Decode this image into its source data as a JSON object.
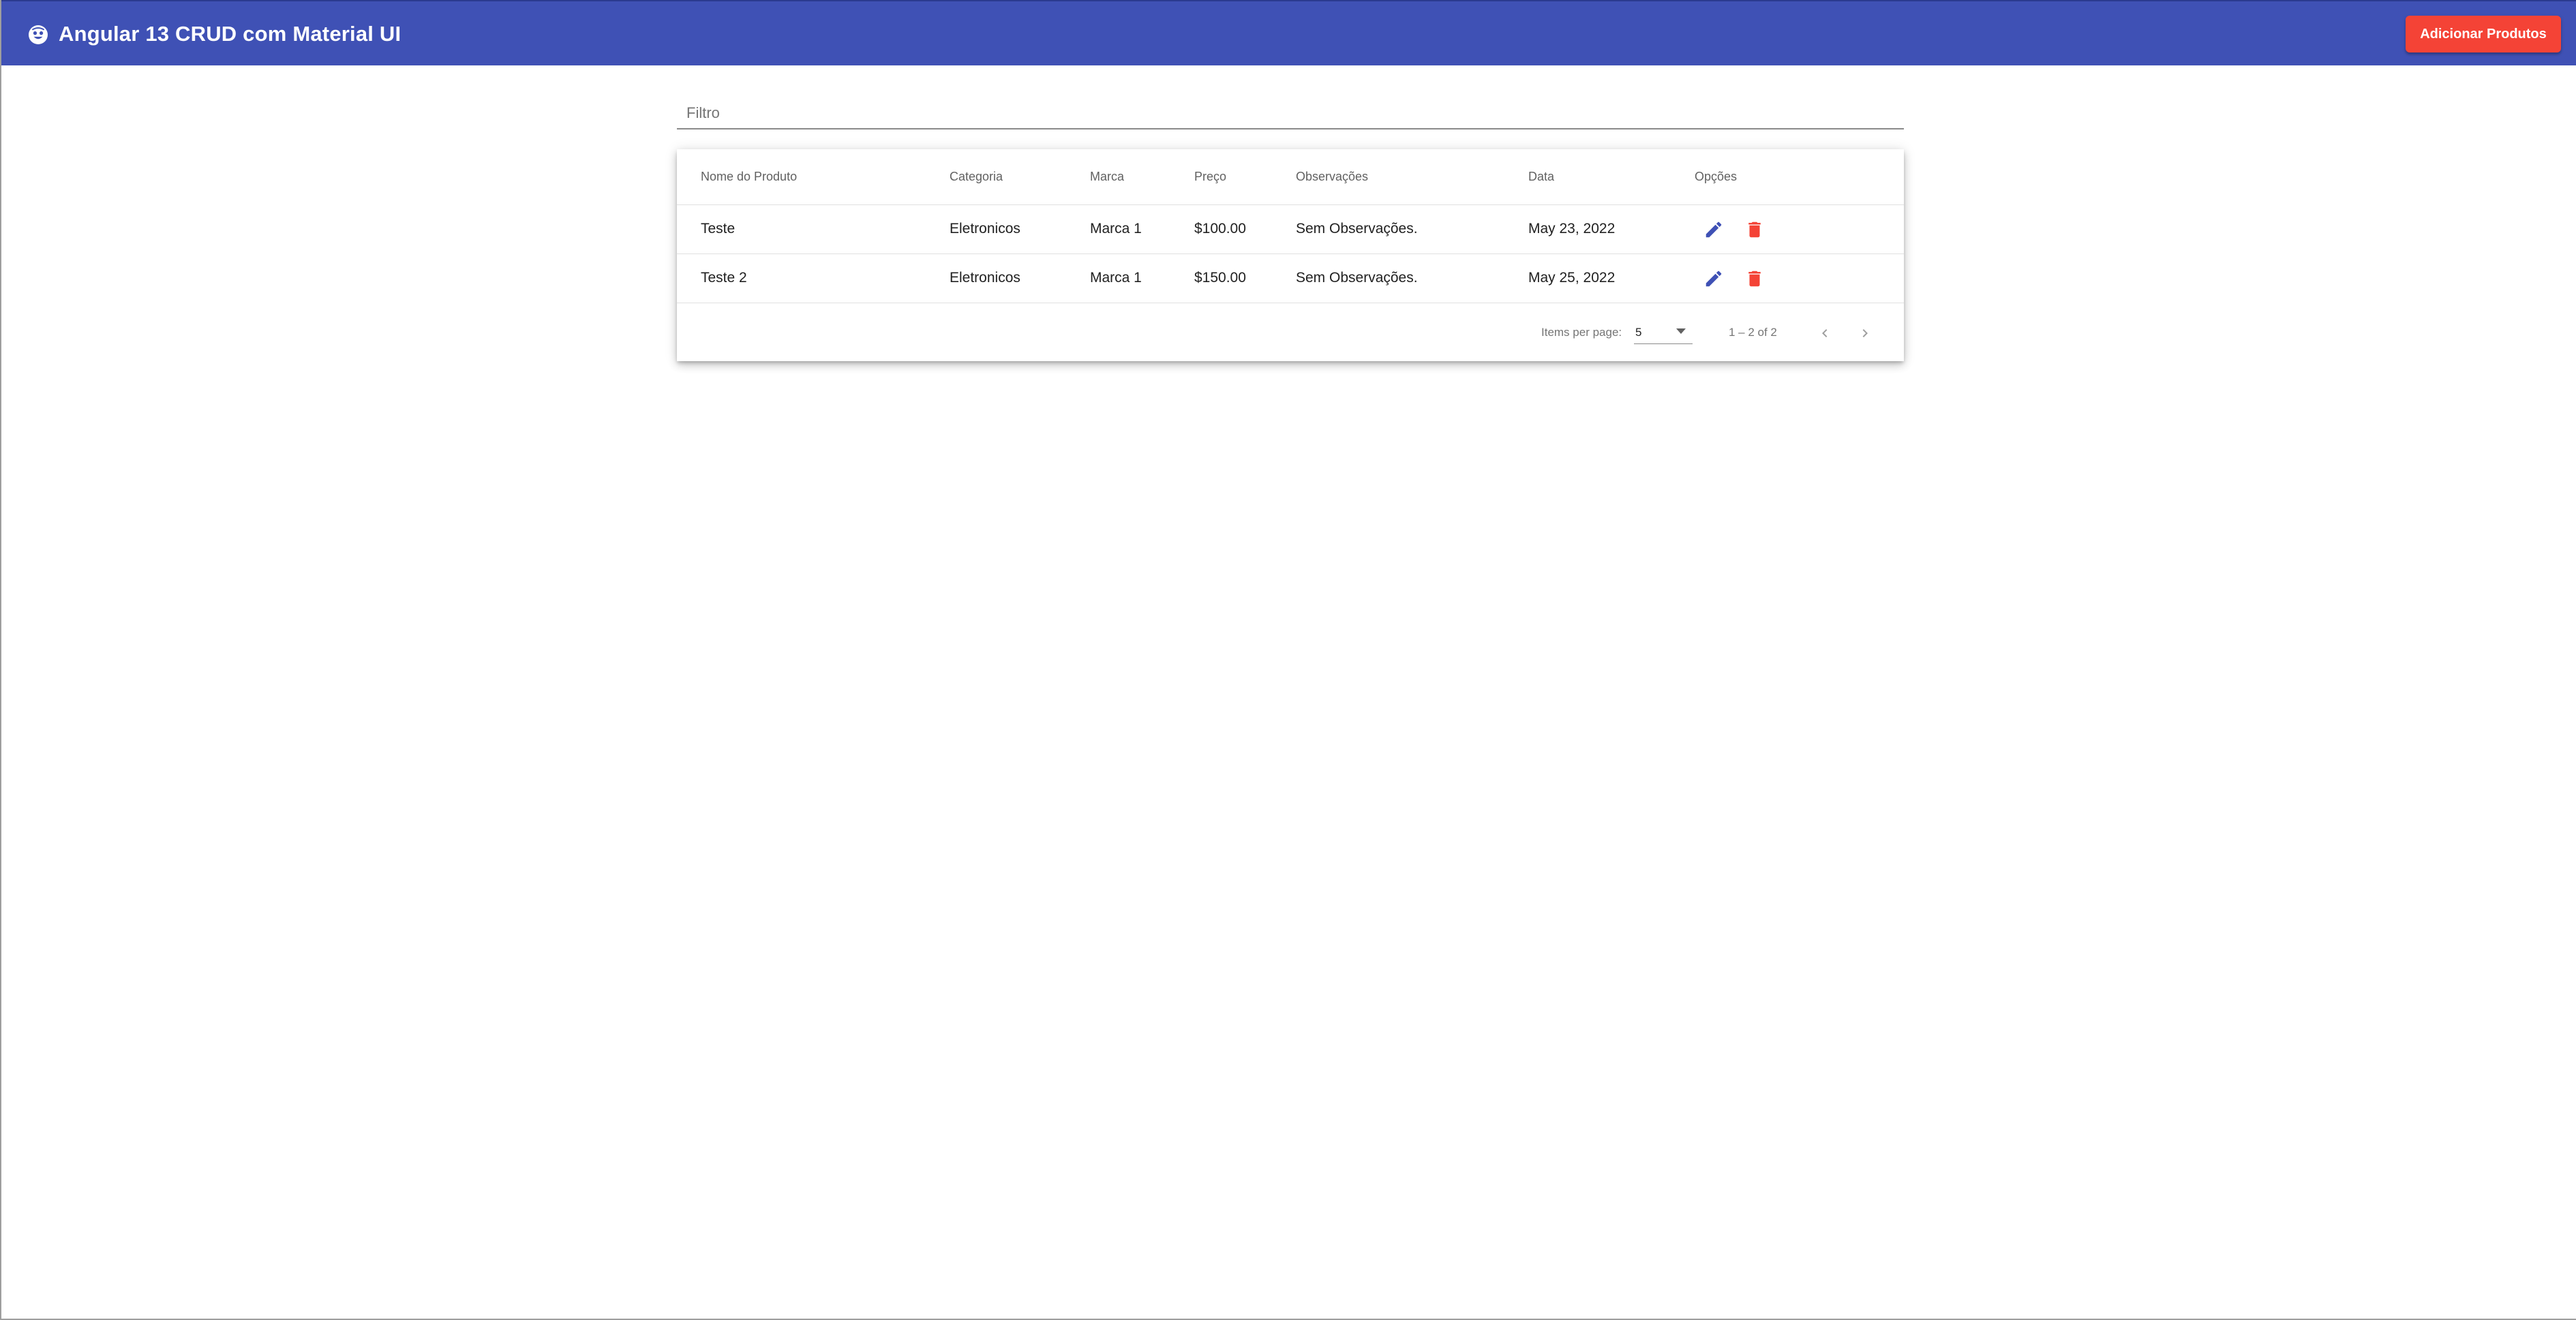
{
  "colors": {
    "primary": "#3f51b5",
    "warn": "#f44336",
    "text": "#212121",
    "muted": "#757575"
  },
  "toolbar": {
    "logo_icon": "face-icon",
    "title": "Angular 13 CRUD com Material UI",
    "add_button_label": "Adicionar Produtos"
  },
  "filter": {
    "placeholder": "Filtro",
    "value": ""
  },
  "table": {
    "columns": [
      "Nome do Produto",
      "Categoria",
      "Marca",
      "Preço",
      "Observações",
      "Data",
      "Opções"
    ],
    "rows": [
      {
        "nome": "Teste",
        "categoria": "Eletronicos",
        "marca": "Marca 1",
        "preco": "$100.00",
        "observacoes": "Sem Observações.",
        "data": "May 23, 2022",
        "actions": [
          "edit-icon",
          "delete-icon"
        ]
      },
      {
        "nome": "Teste 2",
        "categoria": "Eletronicos",
        "marca": "Marca 1",
        "preco": "$150.00",
        "observacoes": "Sem Observações.",
        "data": "May 25, 2022",
        "actions": [
          "edit-icon",
          "delete-icon"
        ]
      }
    ]
  },
  "paginator": {
    "items_per_page_label": "Items per page:",
    "page_size": "5",
    "range_label": "1 – 2 of 2",
    "prev_icon": "chevron-left-icon",
    "next_icon": "chevron-right-icon"
  }
}
